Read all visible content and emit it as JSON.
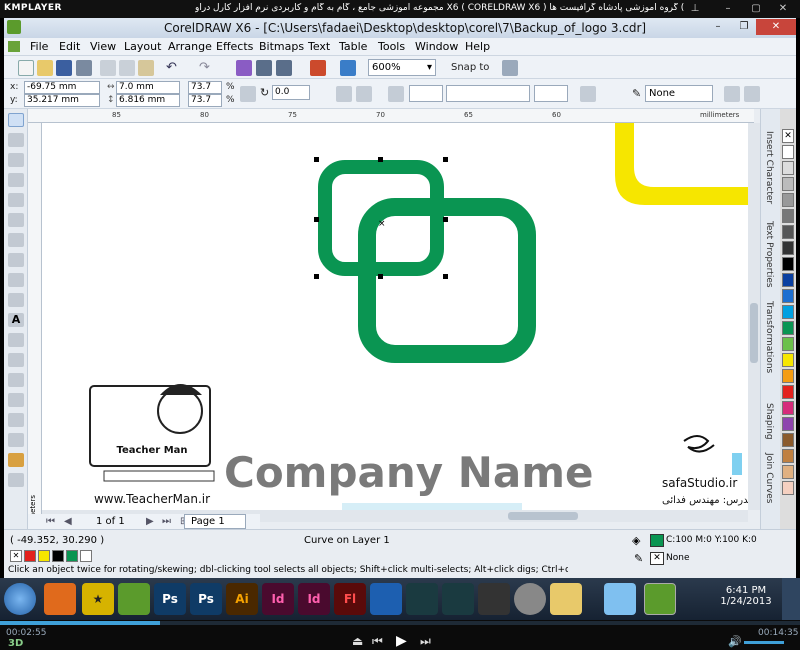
{
  "player": {
    "logo": "KMPLAYER",
    "title": "مجموعه آموزشی جامع ، گام به گام و کاربردی نرم افزار کارل دراو X6 ( CORELDRAW X6 ) مدرس : سعید فدایی (تیچرمن ) گروه آموزشی پادشاه گرافیست ها",
    "time_elapsed": "00:02:55",
    "time_total": "00:14:35",
    "buttons": [
      "pin-icon",
      "minimize-icon",
      "maximize-icon",
      "close-icon"
    ]
  },
  "window": {
    "title": "CorelDRAW X6 - [C:\\Users\\fadaei\\Desktop\\desktop\\corel\\7\\Backup_of_logo 3.cdr]"
  },
  "menu": [
    "File",
    "Edit",
    "View",
    "Layout",
    "Arrange",
    "Effects",
    "Bitmaps",
    "Text",
    "Table",
    "Tools",
    "Window",
    "Help"
  ],
  "toolbar": {
    "zoom": "600%",
    "snap_to": "Snap to"
  },
  "propbar": {
    "x_label": "x:",
    "y_label": "y:",
    "x": "-69.75 mm",
    "y": "35.217 mm",
    "width": "7.0 mm",
    "height": "6.816 mm",
    "scale_x": "73.7",
    "scale_y": "73.7",
    "percent": "%",
    "rotation": "0.0",
    "outline": "None"
  },
  "ruler": {
    "ticks": [
      "85",
      "80",
      "75",
      "70",
      "65",
      "60"
    ],
    "unit": "millimeters"
  },
  "canvas": {
    "company_name": "Company Name",
    "teacherman_url": "www.TeacherMan.ir",
    "teacherman_label": "Teacher Man",
    "safa_studio": "safaStudio.ir",
    "teacher_caption": "مدرس: مهندس فدائی",
    "colors": {
      "green": "#0a9552",
      "yellow": "#f6e600"
    }
  },
  "dockers": [
    "Insert Character",
    "Text Properties",
    "Transformations",
    "Shaping",
    "Join Curves"
  ],
  "page": {
    "counter": "1 of 1",
    "tab": "Page 1"
  },
  "status": {
    "coords": "( -49.352, 30.290 )",
    "layer": "Curve on Layer 1",
    "hint": "Click an object twice for rotating/skewing; dbl-clicking tool selects all objects; Shift+click multi-selects; Alt+click digs; Ctrl+click selects in a group",
    "fill": "C:100 M:0 Y:100 K:0",
    "outline": "None"
  },
  "taskbar": {
    "apps": [
      "Firefox",
      "Star",
      "Corel",
      "Ps",
      "Ps",
      "Ai",
      "Id",
      "Id",
      "Fl",
      "Qb",
      "Ca",
      "Ca",
      "Ai",
      "Dv",
      "Fo",
      "Wn",
      "Cd"
    ],
    "time": "6:41 PM",
    "date": "1/24/2013"
  }
}
